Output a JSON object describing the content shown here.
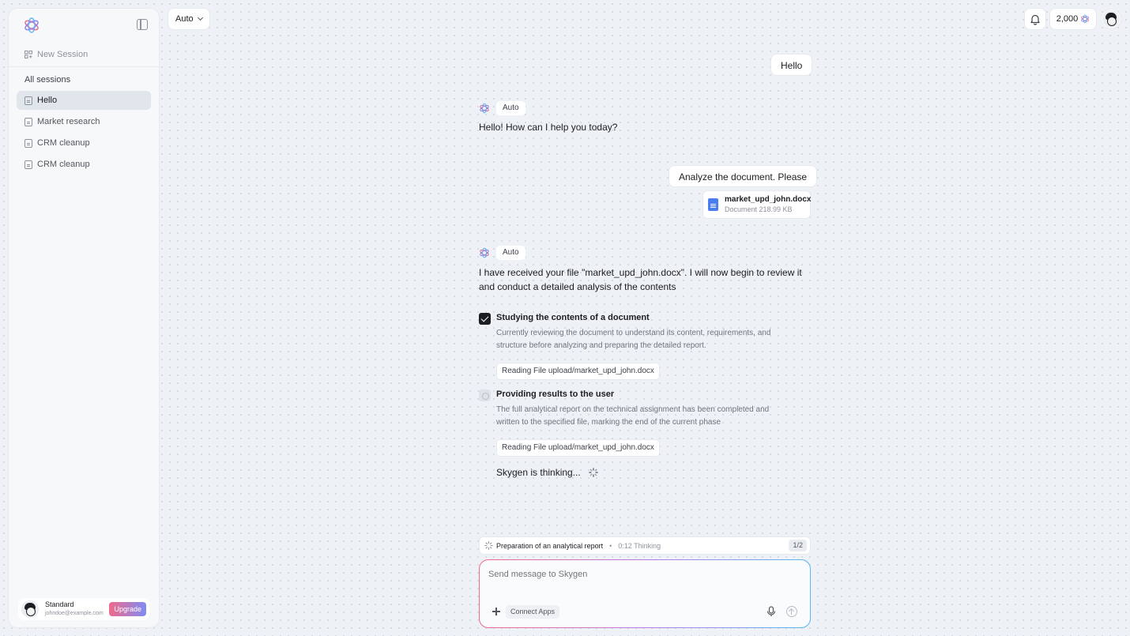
{
  "sidebar": {
    "new_session": "New Session",
    "sessions_heading": "All sessions",
    "sessions": [
      {
        "label": "Hello",
        "active": true
      },
      {
        "label": "Market research",
        "active": false
      },
      {
        "label": "CRM cleanup",
        "active": false
      },
      {
        "label": "CRM cleanup",
        "active": false
      }
    ],
    "user": {
      "plan": "Standard",
      "email": "johndoe@example.com",
      "upgrade_label": "Upgrade"
    }
  },
  "topbar": {
    "model": "Auto",
    "credits": "2,000"
  },
  "chat": {
    "messages": [
      {
        "role": "user",
        "text": "Hello"
      },
      {
        "role": "assistant",
        "model": "Auto",
        "text": "Hello! How can I help you today?"
      },
      {
        "role": "user",
        "text": "Analyze the document. Please",
        "attachment": {
          "name": "market_upd_john.docx",
          "meta": "Document 218.99 KB"
        }
      },
      {
        "role": "assistant",
        "model": "Auto",
        "text": "I have received your file \"market_upd_john.docx\". I will now begin to review it and conduct a detailed analysis of the contents"
      }
    ],
    "steps": [
      {
        "title": "Studying the contents of a document",
        "description": "Currently reviewing the document to understand its content, requirements, and structure before analyzing and preparing the detailed report.",
        "chip": "Reading File upload/market_upd_john.docx",
        "done": true
      },
      {
        "title": "Providing results to the user",
        "description": "The full analytical report on the technical assignment has been completed and written to the specified file, marking the end of the current phase",
        "chip": "Reading File upload/market_upd_john.docx",
        "done": false
      }
    ],
    "thinking": "Skygen is thinking..."
  },
  "task_bar": {
    "title": "Preparation of an analytical report",
    "separator": "•",
    "status": "0:12 Thinking",
    "page": "1/2"
  },
  "composer": {
    "placeholder": "Send message to Skygen",
    "connect_label": "Connect Apps"
  },
  "colors": {
    "accent_gradient_start": "#f06a8a",
    "accent_gradient_end": "#57b7f5",
    "file_icon": "#4a7ef0"
  },
  "icons": {
    "logo": "atom-logo-icon",
    "sidebar_toggle": "sidebar-toggle-icon",
    "notifications": "bell-icon",
    "mic": "microphone-icon",
    "send": "arrow-up-icon"
  }
}
